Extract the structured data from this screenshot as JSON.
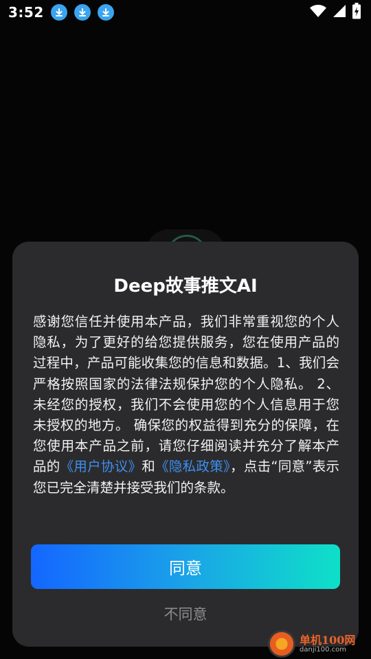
{
  "status_bar": {
    "time": "3:52",
    "left_icons": [
      "download-icon",
      "download-icon",
      "download-icon"
    ],
    "right_icons": [
      "wifi-icon",
      "signal-icon",
      "battery-charging-icon"
    ]
  },
  "dialog": {
    "title": "Deep故事推文AI",
    "body_part1": "感谢您信任并使用本产品，我们非常重视您的个人隐私，为了更好的给您提供服务，您在使用产品的过程中，产品可能收集您的信息和数据。1、我们会严格按照国家的法律法规保护您的个人隐私。 2、未经您的授权，我们不会使用您的个人信息用于您未授权的地方。 确保您的权益得到充分的保障，在您使用本产品之前，请您仔细阅读并充分了解本产品的",
    "link_user_agreement": "《用户协议》",
    "body_and": "和",
    "link_privacy_policy": "《隐私政策》",
    "body_part2": "，点击“同意”表示您已完全清楚并接受我们的条款。",
    "agree_label": "同意",
    "disagree_label": "不同意"
  },
  "watermark": {
    "name": "单机100网",
    "url": "danji100.com"
  },
  "colors": {
    "background": "#050505",
    "dialog": "#2b2b2d",
    "link": "#3d8ff0",
    "button_gradient_start": "#1466ff",
    "button_gradient_end": "#0ee0c8",
    "disagree_text": "#8d8d8d"
  }
}
